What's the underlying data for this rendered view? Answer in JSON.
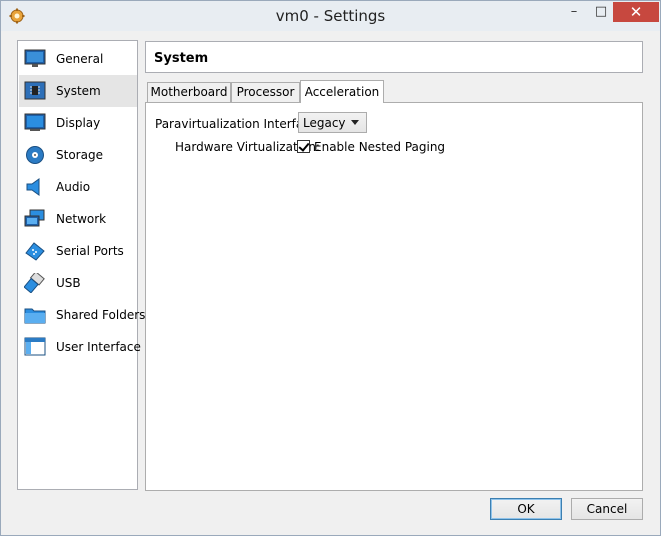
{
  "window": {
    "title": "vm0 - Settings",
    "minimize": "–",
    "maximize": "□",
    "close": "✕"
  },
  "sidebar": {
    "selected": "System",
    "items": [
      {
        "label": "General",
        "icon": "monitor-icon"
      },
      {
        "label": "System",
        "icon": "chip-icon"
      },
      {
        "label": "Display",
        "icon": "display-icon"
      },
      {
        "label": "Storage",
        "icon": "disk-icon"
      },
      {
        "label": "Audio",
        "icon": "speaker-icon"
      },
      {
        "label": "Network",
        "icon": "network-icon"
      },
      {
        "label": "Serial Ports",
        "icon": "serial-port-icon"
      },
      {
        "label": "USB",
        "icon": "usb-icon"
      },
      {
        "label": "Shared Folders",
        "icon": "folder-icon"
      },
      {
        "label": "User Interface",
        "icon": "window-icon"
      }
    ]
  },
  "page": {
    "title": "System",
    "tabs": [
      "Motherboard",
      "Processor",
      "Acceleration"
    ],
    "active_tab": "Acceleration"
  },
  "acceleration": {
    "paravirt_label": "Paravirtualization Interface:",
    "paravirt_value": "Legacy",
    "hwvirt_label": "Hardware Virtualization:",
    "nested_paging_label": "Enable Nested Paging",
    "nested_paging_checked": true
  },
  "buttons": {
    "ok": "OK",
    "cancel": "Cancel"
  },
  "colors": {
    "accent": "#2b7bc4",
    "close_button": "#c7483f",
    "selection": "#e5e5e5"
  }
}
